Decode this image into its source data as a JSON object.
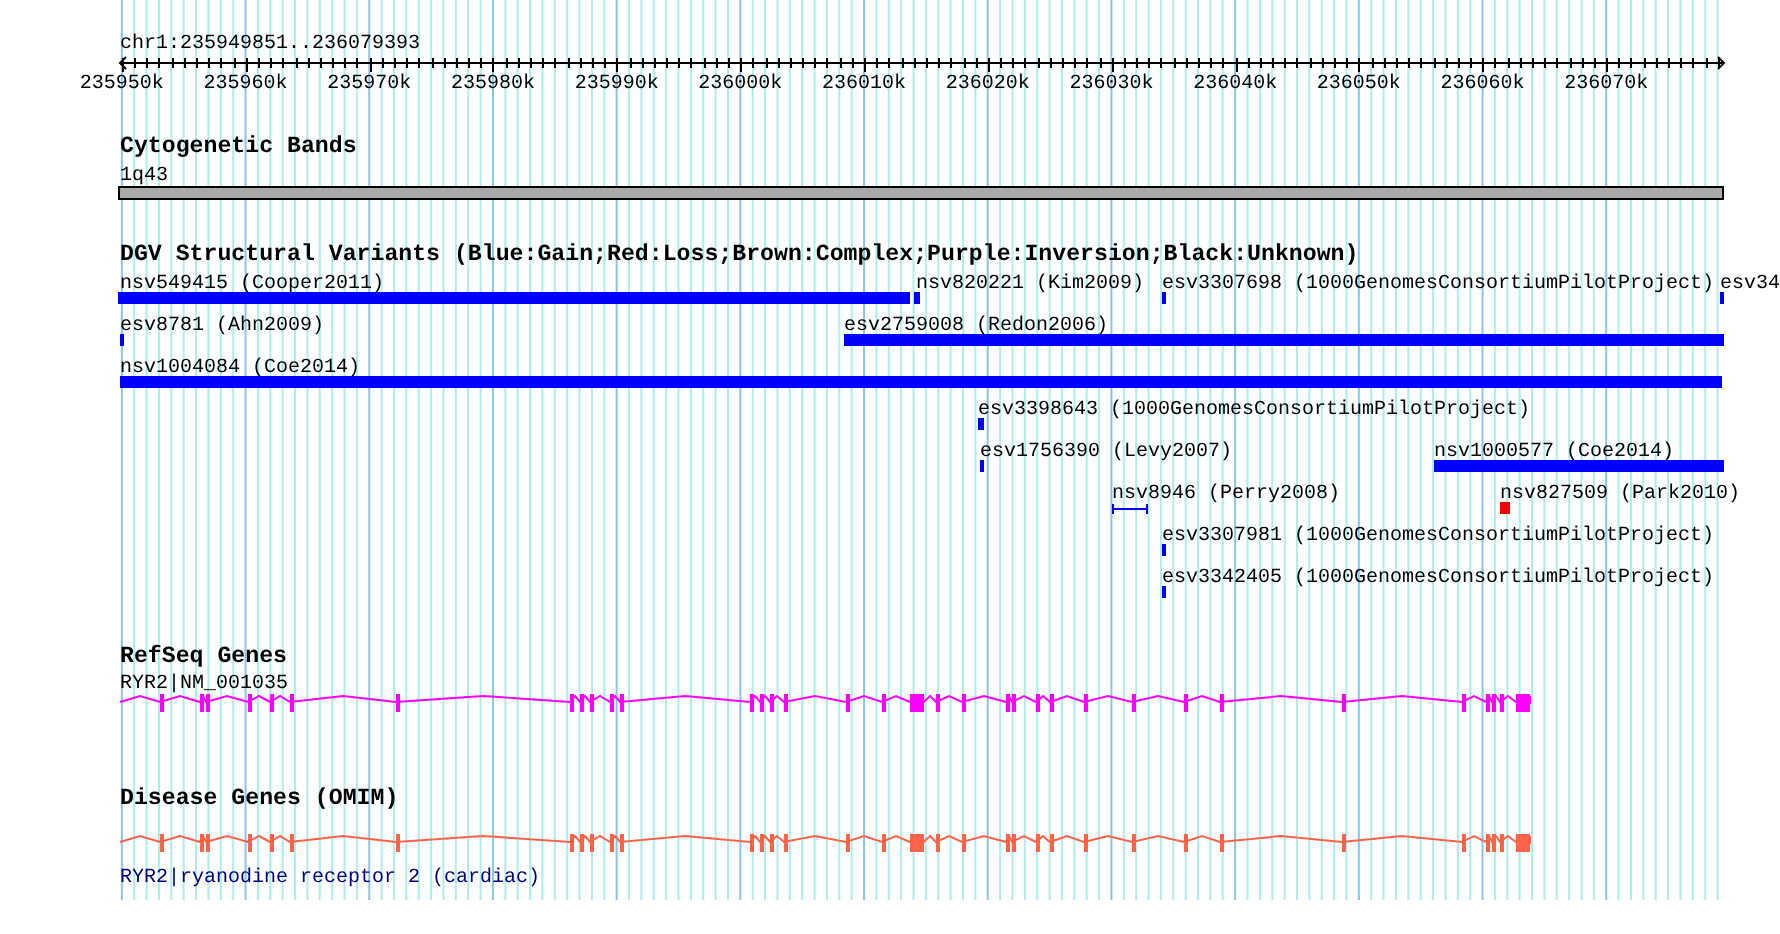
{
  "ruler": {
    "region": "chr1:235949851..236079393",
    "ticks": [
      "235950k",
      "235960k",
      "235970k",
      "235980k",
      "235990k",
      "236000k",
      "236010k",
      "236020k",
      "236030k",
      "236040k",
      "236050k",
      "236060k",
      "236070k"
    ]
  },
  "tracks": [
    {
      "kind": "cytoband",
      "title": "Cytogenetic Bands",
      "features": [
        {
          "label": "1q43"
        }
      ]
    },
    {
      "kind": "variants",
      "title": "DGV Structural Variants (Blue:Gain;Red:Loss;Brown:Complex;Purple:Inversion;Black:Unknown)",
      "features": [
        {
          "label": "nsv549415 (Cooper2011)",
          "kind": "bar",
          "color": "#0000ff"
        },
        {
          "label": "nsv820221 (Kim2009)",
          "kind": "bar",
          "color": "#0000ff"
        },
        {
          "label": "esv3307698 (1000GenomesConsortiumPilotProject)",
          "kind": "bar",
          "color": "#0000ff"
        },
        {
          "label": "esv34",
          "kind": "bar",
          "color": "#0000ff"
        },
        {
          "label": "esv8781 (Ahn2009)",
          "kind": "bar",
          "color": "#0000ff"
        },
        {
          "label": "esv2759008 (Redon2006)",
          "kind": "bar",
          "color": "#0000ff"
        },
        {
          "label": "nsv1004084 (Coe2014)",
          "kind": "bar",
          "color": "#0000ff"
        },
        {
          "label": "esv3398643 (1000GenomesConsortiumPilotProject)",
          "kind": "bar",
          "color": "#0000ff"
        },
        {
          "label": "esv1756390 (Levy2007)",
          "kind": "bar",
          "color": "#0000ff"
        },
        {
          "label": "nsv1000577 (Coe2014)",
          "kind": "bar",
          "color": "#0000ff"
        },
        {
          "label": "nsv8946 (Perry2008)",
          "kind": "span",
          "color": "#0000ff"
        },
        {
          "label": "nsv827509 (Park2010)",
          "kind": "bar",
          "color": "#ff0000"
        },
        {
          "label": "esv3307981 (1000GenomesConsortiumPilotProject)",
          "kind": "bar",
          "color": "#0000ff"
        },
        {
          "label": "esv3342405 (1000GenomesConsortiumPilotProject)",
          "kind": "bar",
          "color": "#0000ff"
        }
      ]
    },
    {
      "kind": "gene",
      "title": "RefSeq Genes",
      "features": [
        {
          "label": "RYR2|NM_001035"
        }
      ]
    },
    {
      "kind": "disease",
      "title": "Disease Genes (OMIM)",
      "features": [
        {
          "label": "RYR2|ryanodine receptor 2 (cardiac)"
        }
      ]
    }
  ]
}
